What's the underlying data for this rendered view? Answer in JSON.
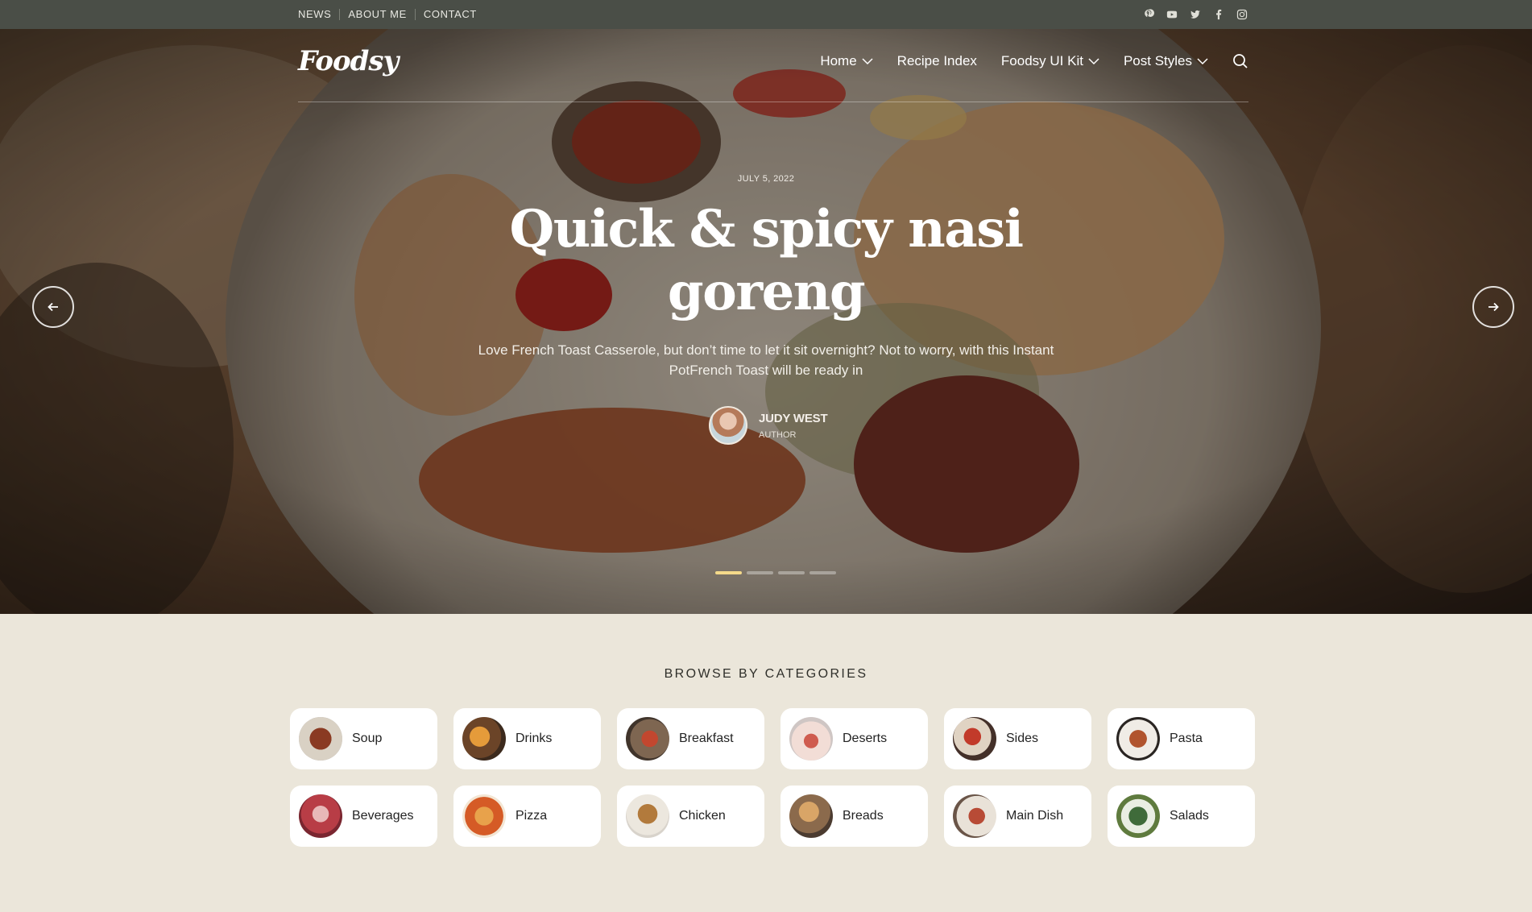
{
  "topbar": {
    "links": [
      "NEWS",
      "ABOUT ME",
      "CONTACT"
    ],
    "social_icons": [
      "pinterest-icon",
      "youtube-icon",
      "twitter-icon",
      "facebook-icon",
      "instagram-icon"
    ]
  },
  "header": {
    "logo": "Foodsy",
    "nav": [
      "Home",
      "Recipe Index",
      "Foodsy UI Kit",
      "Post Styles"
    ]
  },
  "hero": {
    "date": "JULY 5, 2022",
    "title": "Quick & spicy nasi goreng",
    "excerpt": "Love French Toast Casserole, but don’t time to let it sit overnight? Not to worry, with this Instant PotFrench Toast will be ready in",
    "author_name": "JUDY WEST",
    "author_role": "AUTHOR",
    "slides_total": 4,
    "active_slide": 1
  },
  "categories": {
    "title": "BROWSE BY CATEGORIES",
    "items": [
      "Soup",
      "Drinks",
      "Breakfast",
      "Deserts",
      "Sides",
      "Pasta",
      "Beverages",
      "Pizza",
      "Chicken",
      "Breads",
      "Main Dish",
      "Salads"
    ]
  },
  "colors": {
    "topbar": "#4a4e47",
    "page_bg": "#ebe6da",
    "slider_active": "#f4d98a"
  }
}
